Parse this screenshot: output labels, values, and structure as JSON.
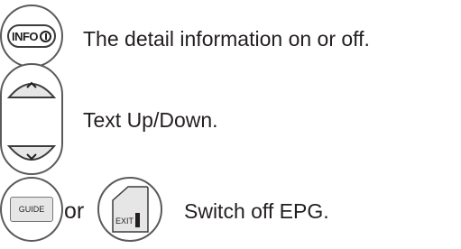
{
  "rows": [
    {
      "button_label": "INFO",
      "button_icon": "info-circle-icon",
      "text": "The detail information on or off."
    },
    {
      "button_icons": [
        "chevron-up-icon",
        "chevron-down-icon"
      ],
      "text": "Text Up/Down."
    },
    {
      "button_label": "GUIDE",
      "connector": "or",
      "second_button_label": "EXIT",
      "text": "Switch off EPG."
    }
  ],
  "colors": {
    "outline": "#5a5a5a",
    "button_fill": "#e6e6e6",
    "text": "#231f20"
  }
}
